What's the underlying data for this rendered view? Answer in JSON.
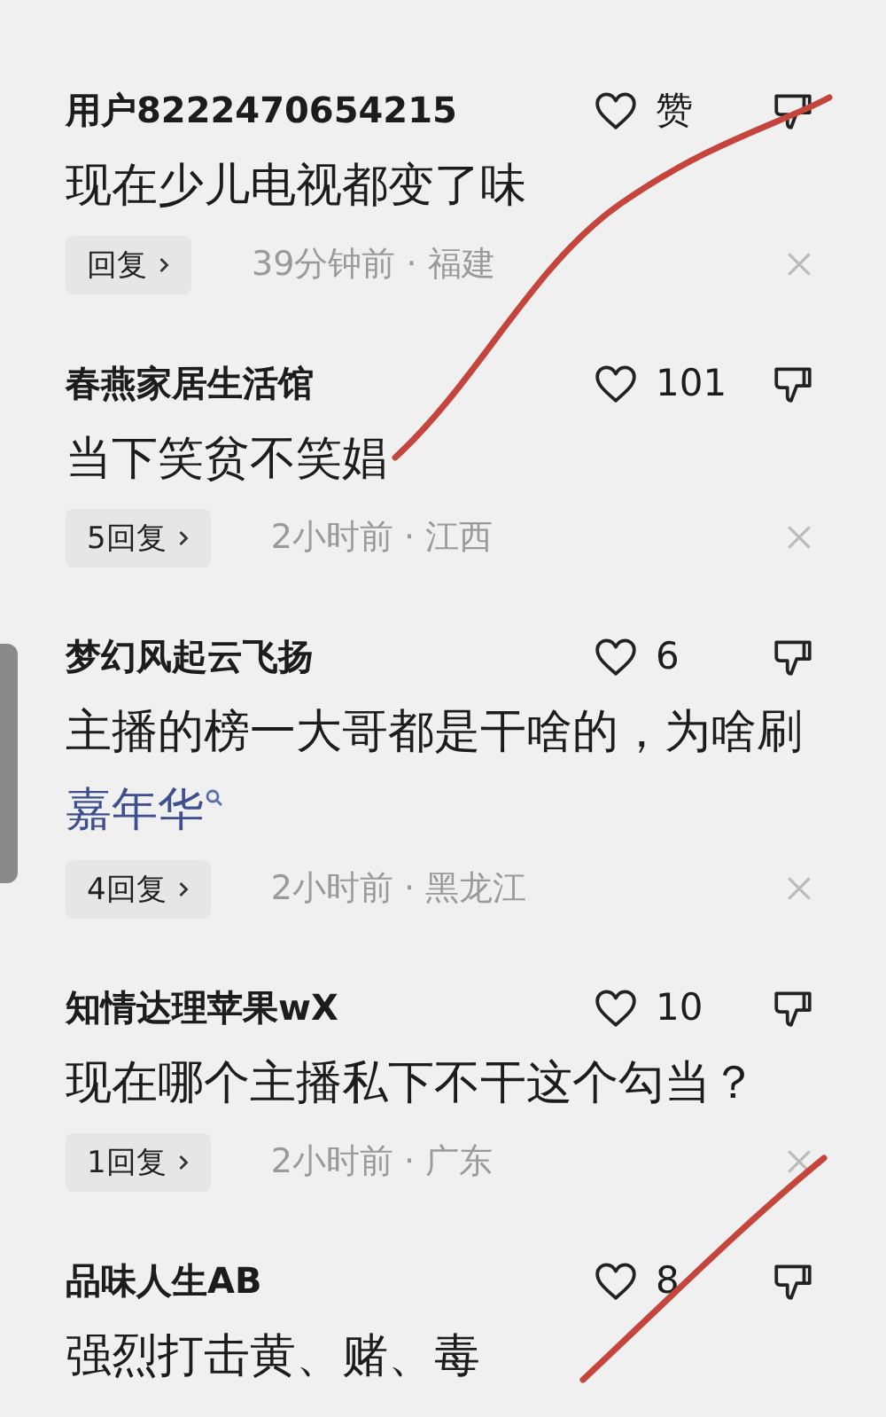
{
  "comments": [
    {
      "user": "用户8222470654215",
      "likes": "赞",
      "parts": [
        {
          "kind": "text",
          "text": "现在少儿电视都变了味"
        }
      ],
      "replies": "回复",
      "meta": "39分钟前 · 福建"
    },
    {
      "user": "春燕家居生活馆",
      "likes": "101",
      "parts": [
        {
          "kind": "text",
          "text": "当下笑贫不笑娼"
        }
      ],
      "replies": "5回复",
      "meta": "2小时前 · 江西"
    },
    {
      "user": "梦幻风起云飞扬",
      "likes": "6",
      "parts": [
        {
          "kind": "text",
          "text": "主播的榜一大哥都是干啥的，为啥刷"
        },
        {
          "kind": "search_link",
          "text": "嘉年华"
        }
      ],
      "replies": "4回复",
      "meta": "2小时前 · 黑龙江"
    },
    {
      "user": "知情达理苹果wX",
      "likes": "10",
      "parts": [
        {
          "kind": "text",
          "text": "现在哪个主播私下不干这个勾当？"
        }
      ],
      "replies": "1回复",
      "meta": "2小时前 · 广东"
    },
    {
      "user": "品味人生AB",
      "likes": "8",
      "parts": [
        {
          "kind": "text",
          "text": "强烈打击黄、赌、毒"
        }
      ]
    }
  ]
}
